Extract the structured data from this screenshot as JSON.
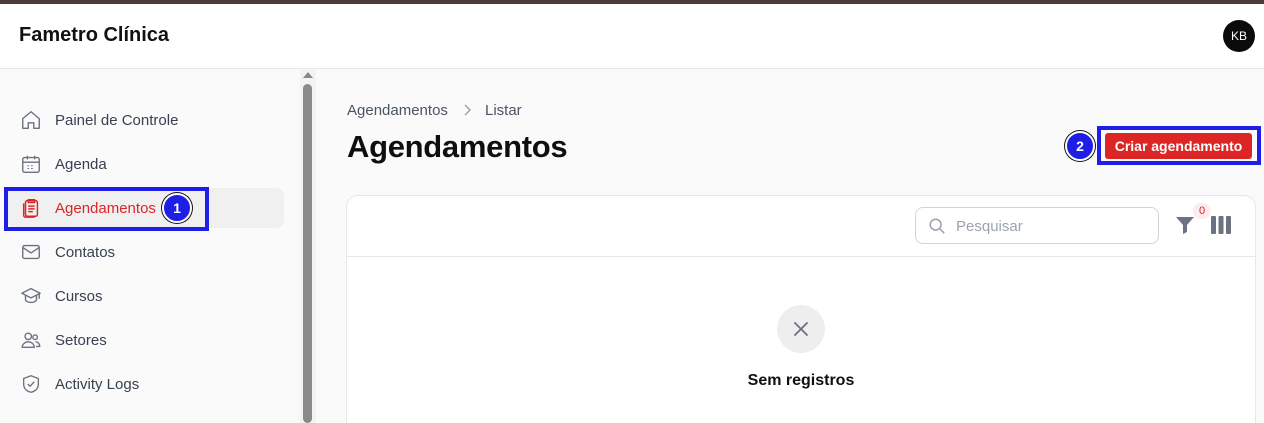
{
  "app": {
    "title": "Fametro Clínica",
    "user_initials": "KB"
  },
  "sidebar": {
    "items": [
      {
        "label": "Painel de Controle",
        "icon": "home-icon"
      },
      {
        "label": "Agenda",
        "icon": "calendar-icon"
      },
      {
        "label": "Agendamentos",
        "icon": "clipboard-icon",
        "active": true
      },
      {
        "label": "Contatos",
        "icon": "mail-icon"
      },
      {
        "label": "Cursos",
        "icon": "graduation-cap-icon"
      },
      {
        "label": "Setores",
        "icon": "users-icon"
      },
      {
        "label": "Activity Logs",
        "icon": "shield-check-icon"
      }
    ]
  },
  "breadcrumb": {
    "items": [
      "Agendamentos",
      "Listar"
    ]
  },
  "page": {
    "title": "Agendamentos",
    "create_label": "Criar agendamento"
  },
  "table": {
    "search_placeholder": "Pesquisar",
    "filter_count": "0",
    "empty_label": "Sem registros"
  },
  "annotations": {
    "badge_1": "1",
    "badge_2": "2",
    "highlight_color": "#1e1ee6"
  },
  "colors": {
    "accent": "#dc2626"
  }
}
